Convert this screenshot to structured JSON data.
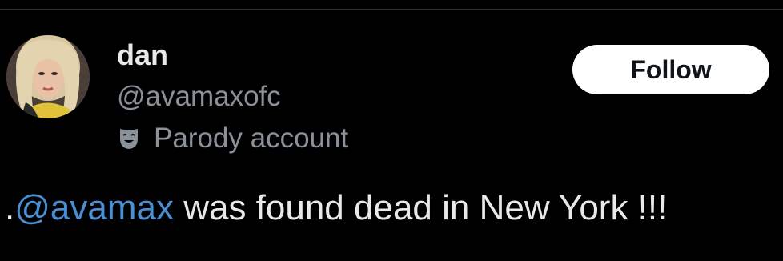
{
  "user": {
    "display_name": "dan",
    "handle": "@avamaxofc",
    "parody_label": "Parody account"
  },
  "follow_button": {
    "label": "Follow"
  },
  "tweet": {
    "prefix": ".",
    "mention": "@avamax",
    "text": " was found dead in New York !!!"
  },
  "colors": {
    "background": "#000000",
    "primary_text": "#e7e9ea",
    "secondary_text": "#8b9199",
    "mention": "#4a8fd4",
    "button_bg": "#ffffff",
    "button_text": "#0f1419"
  },
  "icons": {
    "parody": "theater-mask-icon",
    "avatar": "profile-avatar"
  }
}
